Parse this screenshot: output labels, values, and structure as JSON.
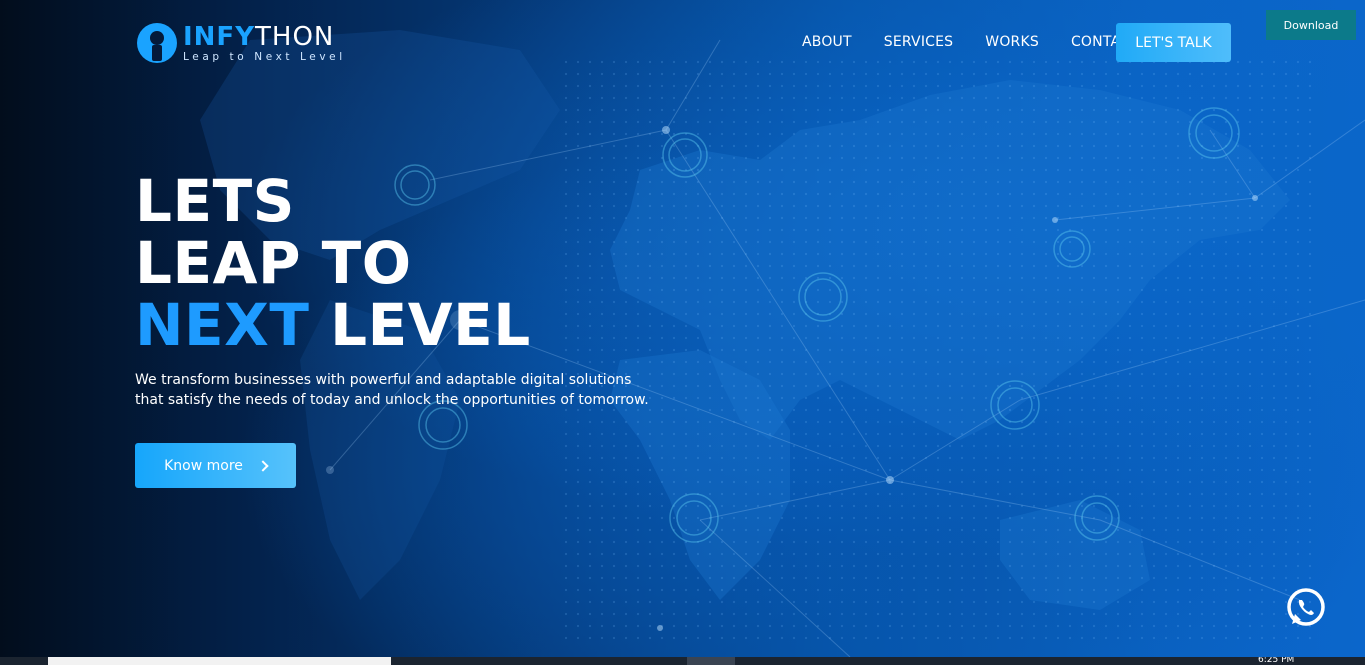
{
  "brand": {
    "name_accent": "INFY",
    "name_rest": "THON",
    "tagline": "Leap to Next Level",
    "accent_color": "#1aa3ff"
  },
  "nav": {
    "items": [
      {
        "label": "ABOUT"
      },
      {
        "label": "SERVICES"
      },
      {
        "label": "WORKS"
      },
      {
        "label": "CONTACT"
      }
    ],
    "cta_label": "LET'S TALK"
  },
  "download_label": "Download",
  "hero": {
    "line1": "LETS",
    "line2": "LEAP TO",
    "line3_accent": "NEXT",
    "line3_rest": "LEVEL",
    "description_line1": "We transform businesses with powerful and adaptable digital solutions",
    "description_line2": "that satisfy the needs of today and unlock the opportunities of tomorrow.",
    "button_label": "Know more"
  },
  "icons": {
    "logo": "infython-logo-icon",
    "button_arrow": "chevron-right-icon",
    "chat": "whatsapp-icon",
    "background": "world-map-network"
  },
  "taskbar": {
    "clock": "6:25 PM"
  },
  "colors": {
    "primary_blue": "#1e9bff",
    "button_gradient_start": "#16a6fb",
    "download_bg": "#0c7a8a",
    "background_dark": "#020d1c",
    "background_blue": "#0b66cb"
  }
}
